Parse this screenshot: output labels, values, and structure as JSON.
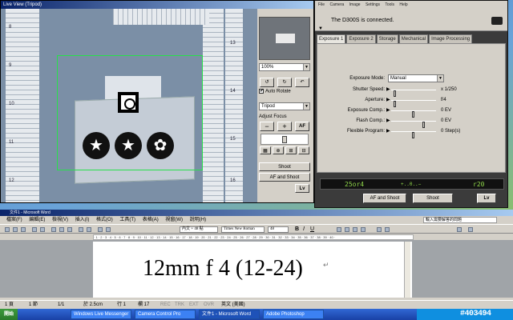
{
  "live_view": {
    "title": "Live View (Tripod)",
    "zoom_select": "100%",
    "auto_rotate_label": "Auto Rotate",
    "auto_rotate_checked": "✔",
    "mode_select": "Tripod",
    "adjust_focus_label": "Adjust Focus",
    "focus_minus": "−",
    "focus_plus": "+",
    "af_label": "AF",
    "shoot_label": "Shoot",
    "af_shoot_label": "AF and Shoot",
    "lv_label": "Lv",
    "ruler_numbers": [
      "8",
      "9",
      "10",
      "11",
      "12",
      "13",
      "14",
      "15",
      "16"
    ]
  },
  "camera_control": {
    "menu": [
      "File",
      "Camera",
      "Image",
      "Settings",
      "Tools",
      "Help"
    ],
    "status": "The D300S is connected.",
    "tabs": [
      "Exposure 1",
      "Exposure 2",
      "Storage",
      "Mechanical",
      "Image Processing"
    ],
    "active_tab": "Exposure 1",
    "exposure_mode_label": "Exposure Mode:",
    "exposure_mode_value": "Manual",
    "shutter_label": "Shutter Speed:",
    "shutter_value": "x 1/250",
    "aperture_label": "Aperture:",
    "aperture_value": "f/4",
    "exp_comp_label": "Exposure Comp.:",
    "exp_comp_value": "0 EV",
    "flash_comp_label": "Flash Comp.:",
    "flash_comp_value": "0 EV",
    "flex_label": "Flexible Program:",
    "flex_value": "0 Step(s)",
    "lcd_shutter": "25or4",
    "lcd_meter": "+..0..−",
    "lcd_remaining": "r20",
    "af_shoot_label": "AF and Shoot",
    "shoot_label": "Shoot",
    "lv_label": "Lv",
    "sliders": {
      "shutter": 0.05,
      "aperture": 0.05,
      "exp_comp": 0.5,
      "flash_comp": 0.75,
      "flex": 0.5
    }
  },
  "word": {
    "title": "文件1 - Microsoft Word",
    "menu": [
      "檔案(F)",
      "編輯(E)",
      "檢視(V)",
      "插入(I)",
      "格式(O)",
      "工具(T)",
      "表格(A)",
      "視窗(W)",
      "說明(H)"
    ],
    "help_box": "輸入需要解答的問題",
    "style_box": "內文 + 48 點",
    "font_box": "Times New Roman",
    "size_box": "48",
    "ruler": "· 1 · 2 · 3 · 4 · 5 · 6 · 7 · 8 · 9 · 10 · 11 · 12 · 13 · 14 · 15 · 16 · 17 · 18 · 19 · 20 · 21 · 22 · 23 · 24 · 25 · 26 · 27 · 28 · 29 · 30 · 31 · 32 · 33 · 34 · 35 · 36 · 37 · 38 · 39 · 40 ·",
    "document_text": "12mm f 4 (12-24)",
    "status": {
      "page": "1 頁",
      "section": "1 節",
      "pages": "1/1",
      "position": "於 2.5cm",
      "line": "行 1",
      "column": "欄 17",
      "rec": "REC",
      "trk": "TRK",
      "ext": "EXT",
      "ovr": "OVR",
      "lang": "英文 (美國)"
    }
  },
  "taskbar": {
    "start": "開始",
    "tasks": [
      "Windows Live Messenger",
      "Camera Control Pro",
      "文件1 - Microsoft Word",
      "Adobe Photoshop"
    ],
    "active_task": "文件1 - Microsoft Word"
  },
  "watermark": "#403494",
  "colors": {
    "af_frame": "#27e04a",
    "lcd_text": "#8fd64a",
    "title_bar": "#0a246a",
    "taskbar": "#3168d5"
  }
}
